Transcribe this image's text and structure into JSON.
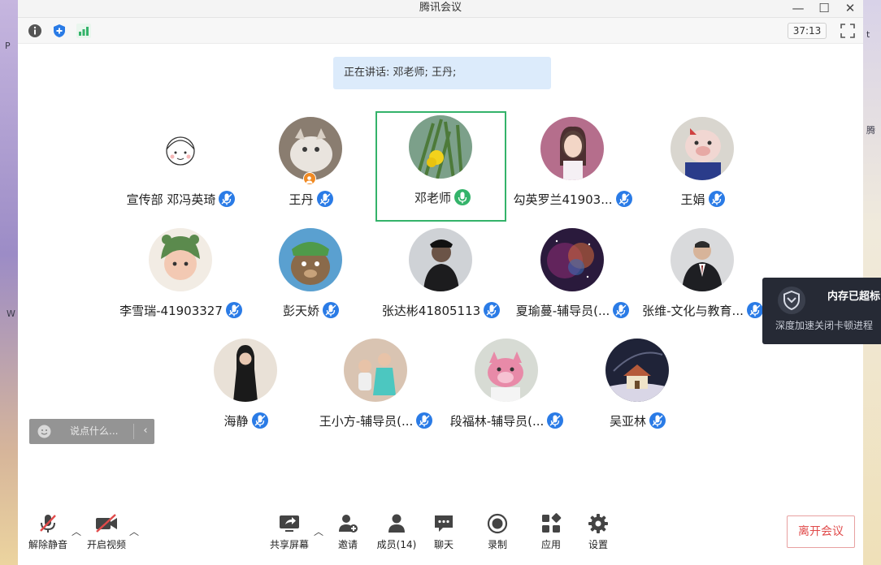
{
  "window": {
    "title": "腾讯会议"
  },
  "timer": "37:13",
  "speaking": "正在讲话: 邓老师; 王丹;",
  "participants": [
    {
      "name": "宣传部 邓冯英琦",
      "mic": "muted-blue",
      "avatar": "cartoon-girl-icon"
    },
    {
      "name": "王丹",
      "mic": "muted-blue",
      "avatar": "cat-photo",
      "host": true
    },
    {
      "name": "邓老师",
      "mic": "speaking-green",
      "avatar": "flower-photo",
      "active": true
    },
    {
      "name": "勾英罗兰41903...",
      "mic": "muted-blue",
      "avatar": "girl-photo"
    },
    {
      "name": "王娟",
      "mic": "muted-blue",
      "avatar": "pig-toy-photo"
    },
    {
      "name": "李雪瑞-41903327",
      "mic": "muted-blue",
      "avatar": "child-green-hat-photo"
    },
    {
      "name": "彭天娇",
      "mic": "muted-blue",
      "avatar": "cartoon-bear-photo"
    },
    {
      "name": "张达彬41805113",
      "mic": "muted-blue",
      "avatar": "man-photo"
    },
    {
      "name": "夏瑜蔓-辅导员(...",
      "mic": "muted-blue",
      "avatar": "galaxy-photo"
    },
    {
      "name": "张维-文化与教育...",
      "mic": "muted-blue",
      "avatar": "man-suit-photo"
    },
    {
      "name": "海静",
      "mic": "muted-blue",
      "avatar": "woman-photo"
    },
    {
      "name": "王小方-辅导员(...",
      "mic": "muted-blue",
      "avatar": "kids-photo"
    },
    {
      "name": "段福林-辅导员(...",
      "mic": "muted-blue",
      "avatar": "pink-pig-photo"
    },
    {
      "name": "吴亚林",
      "mic": "muted-blue",
      "avatar": "house-night-photo"
    }
  ],
  "chat": {
    "placeholder": "说点什么..."
  },
  "toolbar": {
    "unmute": "解除静音",
    "start_video": "开启视频",
    "share": "共享屏幕",
    "invite": "邀请",
    "members": "成员(14)",
    "chat": "聊天",
    "record": "录制",
    "apps": "应用",
    "settings": "设置",
    "leave": "离开会议"
  },
  "popup": {
    "title": "内存已超标",
    "text": "深度加速关闭卡顿进程"
  },
  "colors": {
    "accent_blue": "#2a7be6",
    "speaking_green": "#34b36a",
    "leave_red": "#e04a4a"
  }
}
